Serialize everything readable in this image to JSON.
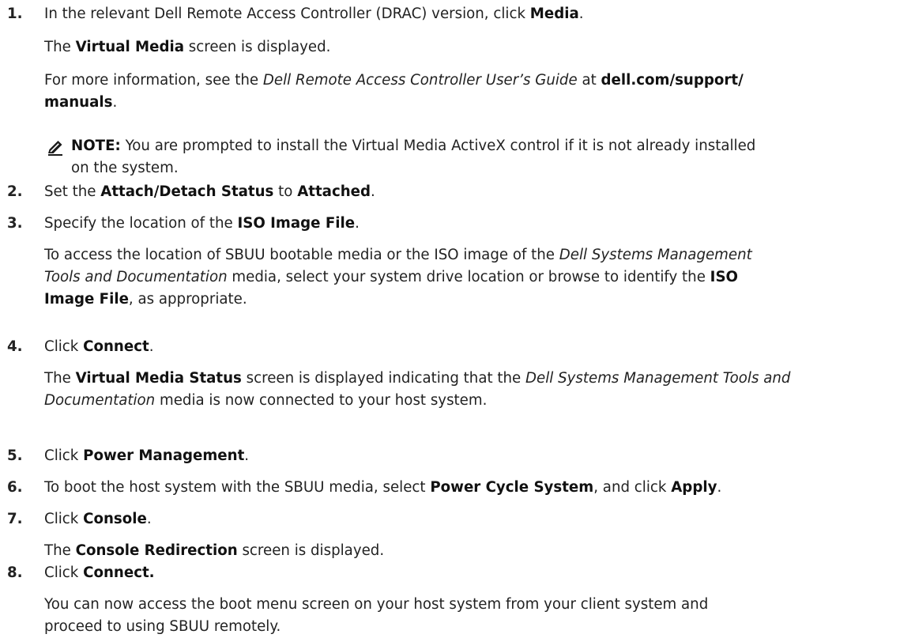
{
  "steps": [
    {
      "num": "1.",
      "lines": [
        [
          "In the relevant Dell Remote Access Controller (DRAC) version, click ",
          {
            "b": "Media"
          },
          "."
        ],
        [
          "The ",
          {
            "b": "Virtual Media"
          },
          " screen is displayed."
        ],
        [
          "For more information, see the ",
          {
            "i": "Dell Remote Access Controller User’s Guide"
          },
          " at ",
          {
            "b": "dell.com/support/"
          }
        ],
        [
          {
            "b": "manuals"
          },
          "."
        ]
      ],
      "note": {
        "icon": "pencil-icon",
        "lines": [
          [
            {
              "b": "NOTE:"
            },
            " You are prompted to install the Virtual Media ActiveX control if it is not already installed"
          ],
          [
            "on the system."
          ]
        ]
      }
    },
    {
      "num": "2.",
      "lines": [
        [
          "Set the ",
          {
            "b": "Attach/Detach Status"
          },
          " to ",
          {
            "b": "Attached"
          },
          "."
        ]
      ]
    },
    {
      "num": "3.",
      "lines": [
        [
          "Specify the location of the ",
          {
            "b": "ISO Image File"
          },
          "."
        ],
        [
          "To access the location of SBUU bootable media or the ISO image of the ",
          {
            "i": "Dell Systems Management"
          }
        ],
        [
          {
            "i": "Tools and Documentation"
          },
          " media, select your system drive location or browse to identify the ",
          {
            "b": "ISO"
          }
        ],
        [
          {
            "b": "Image File"
          },
          ", as appropriate."
        ]
      ]
    },
    {
      "num": "4.",
      "lines": [
        [
          "Click ",
          {
            "b": "Connect"
          },
          "."
        ],
        [
          "The ",
          {
            "b": "Virtual Media Status"
          },
          " screen is displayed indicating that the ",
          {
            "i": "Dell Systems Management Tools and"
          }
        ],
        [
          {
            "i": "Documentation"
          },
          " media is now connected to your host system."
        ]
      ]
    },
    {
      "num": "5.",
      "lines": [
        [
          "Click ",
          {
            "b": "Power Management"
          },
          "."
        ]
      ]
    },
    {
      "num": "6.",
      "lines": [
        [
          "To boot the host system with the SBUU media, select ",
          {
            "b": "Power Cycle System"
          },
          ", and click ",
          {
            "b": "Apply"
          },
          "."
        ]
      ]
    },
    {
      "num": "7.",
      "lines": [
        [
          "Click ",
          {
            "b": "Console"
          },
          "."
        ],
        [
          "The ",
          {
            "b": "Console Redirection"
          },
          " screen is displayed."
        ]
      ]
    },
    {
      "num": "8.",
      "lines": [
        [
          "Click ",
          {
            "b": "Connect."
          }
        ],
        [
          "You can now access the boot menu screen on your host system from your client system and"
        ],
        [
          "proceed to using SBUU remotely."
        ]
      ]
    }
  ]
}
